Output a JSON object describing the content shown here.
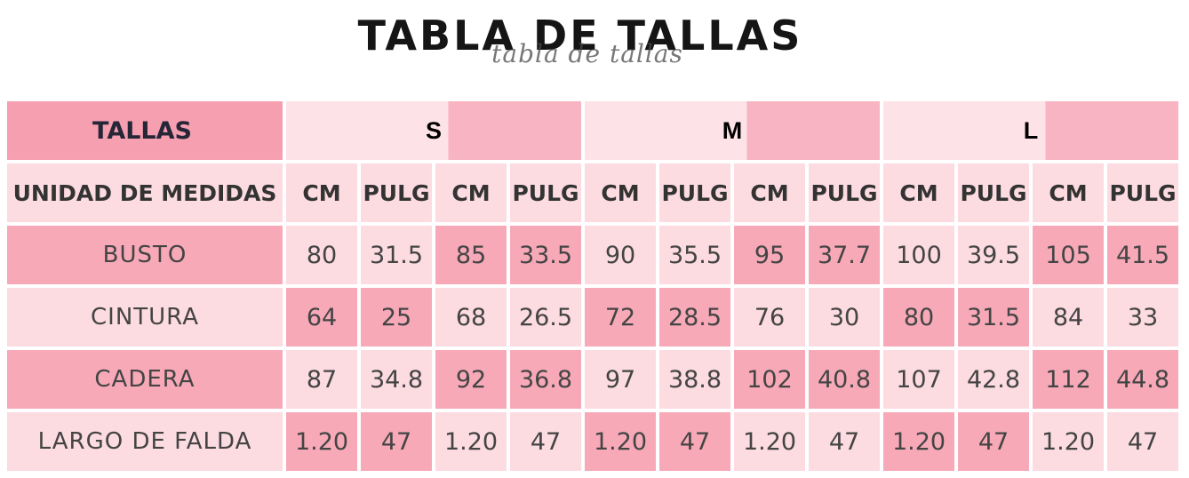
{
  "title": "TABLA DE TALLAS",
  "title_script": "tabla de tallas",
  "header": {
    "label": "TALLAS",
    "sizes": [
      "S",
      "M",
      "L"
    ]
  },
  "units_row": {
    "label": "UNIDAD DE MEDIDAS",
    "units": [
      "CM",
      "PULG",
      "CM",
      "PULG",
      "CM",
      "PULG",
      "CM",
      "PULG",
      "CM",
      "PULG",
      "CM",
      "PULG"
    ]
  },
  "rows": [
    {
      "label": "BUSTO",
      "values": [
        "80",
        "31.5",
        "85",
        "33.5",
        "90",
        "35.5",
        "95",
        "37.7",
        "100",
        "39.5",
        "105",
        "41.5"
      ]
    },
    {
      "label": "CINTURA",
      "values": [
        "64",
        "25",
        "68",
        "26.5",
        "72",
        "28.5",
        "76",
        "30",
        "80",
        "31.5",
        "84",
        "33"
      ]
    },
    {
      "label": "CADERA",
      "values": [
        "87",
        "34.8",
        "92",
        "36.8",
        "97",
        "38.8",
        "102",
        "40.8",
        "107",
        "42.8",
        "112",
        "44.8"
      ]
    },
    {
      "label": "LARGO DE FALDA",
      "values": [
        "1.20",
        "47",
        "1.20",
        "47",
        "1.20",
        "47",
        "1.20",
        "47",
        "1.20",
        "47",
        "1.20",
        "47"
      ]
    }
  ],
  "colors": {
    "pink": "#f7a9b8",
    "light_pink": "#fcdbe1",
    "header_pink": "#f59fb0",
    "title": "#151515"
  }
}
